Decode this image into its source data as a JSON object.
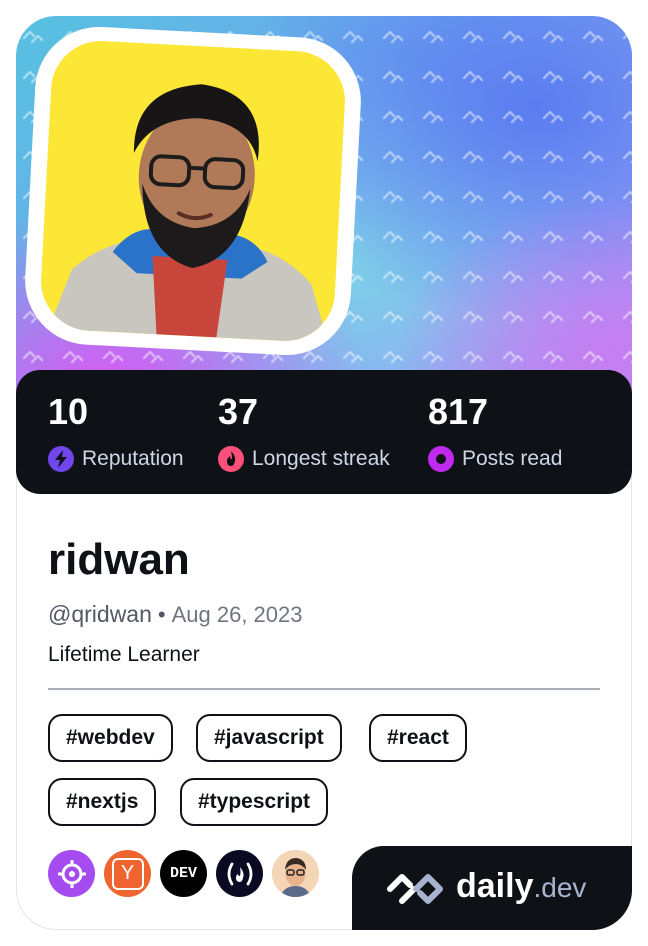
{
  "profile": {
    "name": "ridwan",
    "handle": "@qridwan",
    "separator": "•",
    "joined": "Aug 26, 2023",
    "bio": "Lifetime Learner"
  },
  "stats": [
    {
      "value": "10",
      "label": "Reputation",
      "icon": "bolt-icon",
      "color": "#7147ed"
    },
    {
      "value": "37",
      "label": "Longest streak",
      "icon": "flame-icon",
      "color": "#ff4f7b"
    },
    {
      "value": "817",
      "label": "Posts read",
      "icon": "reading-ring-icon",
      "color": "#c029f0"
    }
  ],
  "tags": [
    "#webdev",
    "#javascript",
    "#react",
    "#nextjs",
    "#typescript"
  ],
  "sources": [
    {
      "icon": "crosshair-icon",
      "color": "#a54bf0"
    },
    {
      "icon": "ycombinator-icon",
      "label": "Y",
      "color": "#f0652f"
    },
    {
      "icon": "dev-to-icon",
      "label": "DEV",
      "color": "#000000"
    },
    {
      "icon": "freecodecamp-icon",
      "label": "(🔥)",
      "color": "#0a0a23"
    },
    {
      "icon": "avatar-source-icon",
      "color": "#f4d6b6"
    }
  ],
  "brand": {
    "name": "daily",
    "suffix": ".dev"
  }
}
